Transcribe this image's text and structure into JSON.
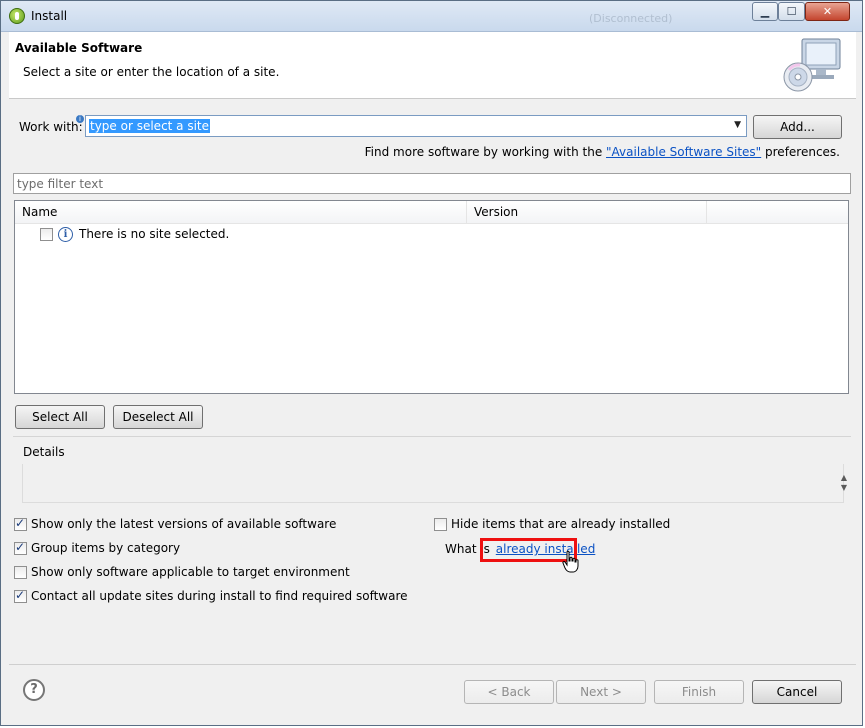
{
  "window": {
    "title": "Install",
    "background_title": "(Disconnected)",
    "controls": {
      "minimize": "▁",
      "maximize": "☐",
      "close": "✕"
    }
  },
  "header": {
    "title": "Available Software",
    "subtitle": "Select a site or enter the location of a site.",
    "icon": "computer-cd-icon"
  },
  "work_with": {
    "label": "Work with:",
    "value": "type or select a site",
    "add_button": "Add...",
    "find_more_prefix": "Find more software by working with the ",
    "find_more_link": "\"Available Software Sites\"",
    "find_more_suffix": " preferences."
  },
  "filter": {
    "placeholder": "type filter text"
  },
  "table": {
    "columns": [
      "Name",
      "Version"
    ],
    "rows": [
      {
        "checked": false,
        "icon": "info-icon",
        "text": "There is no site selected."
      }
    ]
  },
  "selection_buttons": {
    "select_all": "Select All",
    "deselect_all": "Deselect All"
  },
  "details": {
    "label": "Details"
  },
  "options": {
    "latest_versions": {
      "label": "Show only the latest versions of available software",
      "checked": true
    },
    "group_by_category": {
      "label": "Group items by category",
      "checked": true
    },
    "applicable_only": {
      "label": "Show only software applicable to target environment",
      "checked": false
    },
    "contact_sites": {
      "label": "Contact all update sites during install to find required software",
      "checked": true
    },
    "hide_installed": {
      "label": "Hide items that are already installed",
      "checked": false
    },
    "what_is_prefix": "What is",
    "already_installed_link": "already installed"
  },
  "footer": {
    "back": "< Back",
    "next": "Next >",
    "finish": "Finish",
    "cancel": "Cancel"
  },
  "colors": {
    "link": "#0b52c4",
    "highlight": "#ee1010",
    "selection": "#3399ff"
  }
}
